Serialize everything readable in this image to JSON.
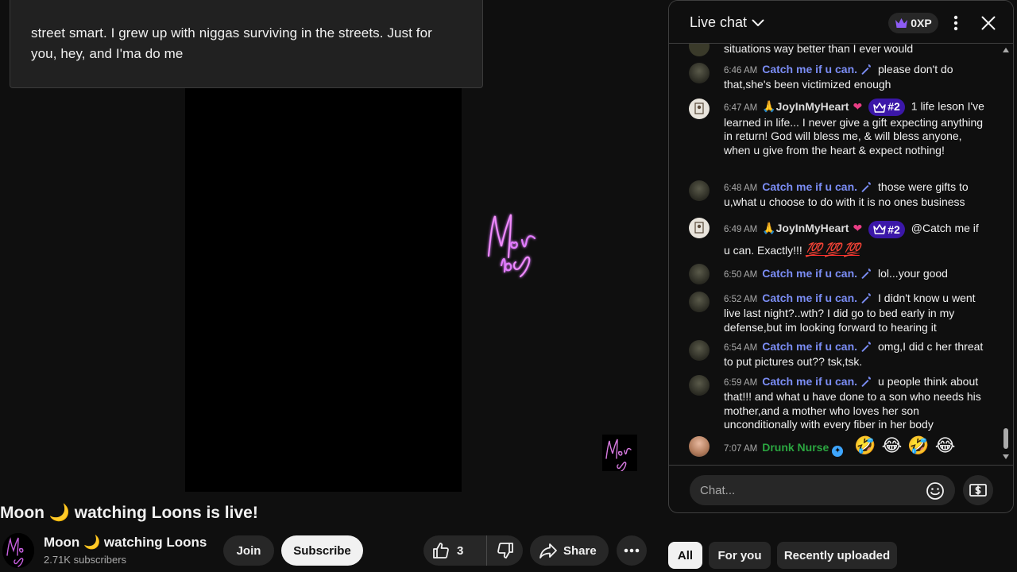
{
  "caption": {
    "text": "street smart. I grew up with niggas surviving in the streets. Just for you, hey, and I'ma do me"
  },
  "video": {
    "title": "Moon 🌙 watching Loons is live!",
    "logo_icon": "moon-neon-signature"
  },
  "owner": {
    "channel_name": "Moon 🌙 watching Loons",
    "subscribers": "2.71K subscribers",
    "join_label": "Join",
    "subscribe_label": "Subscribe"
  },
  "actions": {
    "like_count": "3",
    "share_label": "Share"
  },
  "chips": [
    "All",
    "For you",
    "Recently uploaded"
  ],
  "chat": {
    "title": "Live chat",
    "xp": "0XP",
    "input_placeholder": "Chat...",
    "messages": [
      {
        "time": "",
        "author": "",
        "text": "situations way better than I ever would"
      },
      {
        "time": "6:46 AM",
        "author": "Catch me if u can.",
        "text": "please don't do that,she's been victimized enough"
      },
      {
        "time": "6:47 AM",
        "author": "JoyInMyHeart",
        "rank": "#2",
        "text": "1 life leson I've learned in life... I never give a gift expecting anything in return! God will bless me, & will bless anyone, when u give from the heart & expect nothing!"
      },
      {
        "time": "6:48 AM",
        "author": "Catch me if u can.",
        "text": "those were gifts to u,what u choose to do with it is no ones business"
      },
      {
        "time": "6:49 AM",
        "author": "JoyInMyHeart",
        "rank": "#2",
        "text": "@Catch me if u can. Exactly!!!",
        "extra": "💯 💯 💯"
      },
      {
        "time": "6:50 AM",
        "author": "Catch me if u can.",
        "text": "lol...your good"
      },
      {
        "time": "6:52 AM",
        "author": "Catch me if u can.",
        "text": "I didn't know u went live last night?..wth? I did go to bed early in my defense,but im looking forward to hearing it"
      },
      {
        "time": "6:54 AM",
        "author": "Catch me if u can.",
        "text": "omg,I did c her threat to put pictures out?? tsk,tsk."
      },
      {
        "time": "6:59 AM",
        "author": "Catch me if u can.",
        "text": "u people think about that!!! and what u have done to a son who needs his mother,and a mother who loves her son unconditionally with every fiber in her body"
      },
      {
        "time": "7:07 AM",
        "author": "Drunk Nurse",
        "text": "🤣 😂 🤣 😂"
      }
    ]
  },
  "colors": {
    "background": "#0f0f0f",
    "moderator_name": "#7b8df5",
    "member_name": "#2ba640",
    "rank_badge": "#3b17a8",
    "pill_bg": "#272727"
  }
}
